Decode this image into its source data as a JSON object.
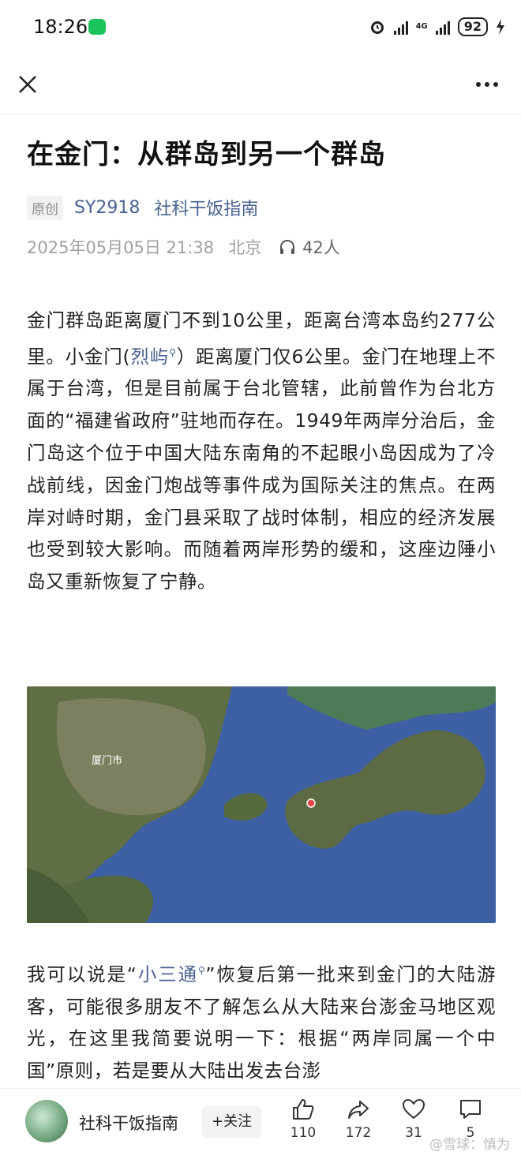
{
  "status": {
    "time": "18:26",
    "battery": "92",
    "network": "4G"
  },
  "article": {
    "title": "在金门：从群岛到另一个群岛",
    "original_tag": "原创",
    "account": "SY2918",
    "channel": "社科干饭指南",
    "date": "2025年05月05日 21:38",
    "location": "北京",
    "listeners": "42人",
    "para1": {
      "a": "金门群岛距离厦门不到10公里，距离台湾本岛约277公里。小金门(",
      "kw": "烈屿",
      "b": "）距离厦门仅6公里。金门在地理上不属于台湾，但是目前属于台北管辖，此前曾作为台北方面的“福建省政府”驻地而存在。1949年两岸分治后，金门岛这个位于中国大陆东南角的不起眼小岛因成为了冷战前线，因金门炮战等事件成为国际关注的焦点。在两岸对峙时期，金门县采取了战时体制，相应的经济发展也受到较大影响。而随着两岸形势的缓和，这座边陲小岛又重新恢复了宁静。"
    },
    "map": {
      "city_label": "厦门市",
      "water_color": "#3d5fa3",
      "land_color": "#5f6e45"
    },
    "para2": {
      "a": "我可以说是“",
      "kw": "小三通",
      "b": "”恢复后第一批来到金门的大陆游客，可能很多朋友不了解怎么从大陆来台澎金马地区观光，在这里我简要说明一下：根据“两岸同属一个中国”原则，若是要从大陆出发去台澎"
    }
  },
  "bottom": {
    "author": "社科干饭指南",
    "follow": "+关注",
    "likes": "110",
    "shares": "172",
    "favorites": "31",
    "comments": "5",
    "watermark": "@雪球：慎为"
  }
}
